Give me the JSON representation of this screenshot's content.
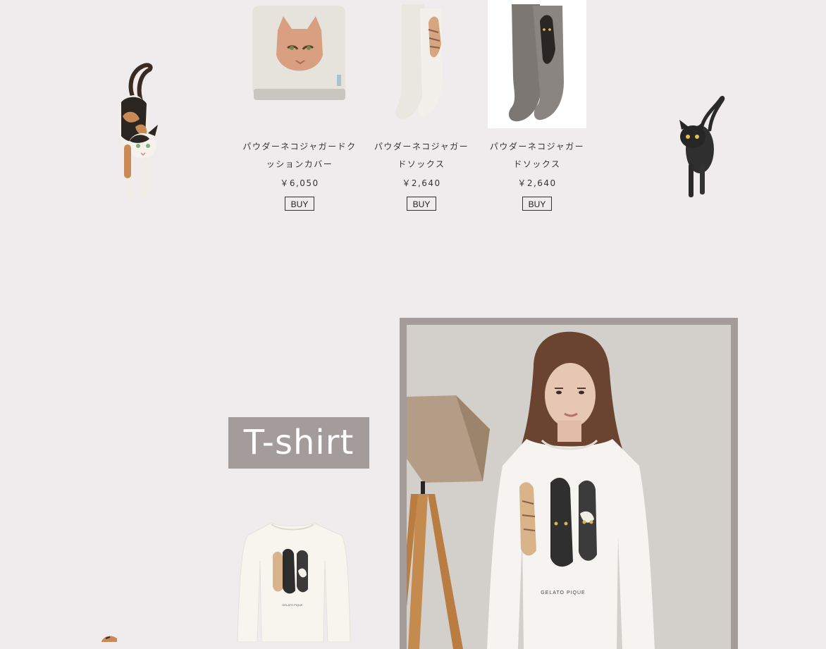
{
  "products": [
    {
      "name_line1": "パウダーネコジャガードク",
      "name_line2": "ッションカバー",
      "price": "￥6,050",
      "buy_label": "BUY"
    },
    {
      "name_line1": "パウダーネコジャガー",
      "name_line2": "ドソックス",
      "price": "￥2,640",
      "buy_label": "BUY"
    },
    {
      "name_line1": "パウダーネコジャガー",
      "name_line2": "ドソックス",
      "price": "￥2,640",
      "buy_label": "BUY"
    }
  ],
  "section": {
    "title": "T-shirt"
  },
  "shirt_print": {
    "brand": "GELATO PIQUE"
  },
  "colors": {
    "background": "#f0eced",
    "label_bg": "#a39c9b",
    "label_text": "#ffffff"
  },
  "icons": [
    "calico-cat-illustration",
    "black-cat-illustration",
    "cat-cushion-image",
    "cat-sock-image",
    "black-cat-sock-image",
    "cat-tshirt-image",
    "model-photo"
  ]
}
